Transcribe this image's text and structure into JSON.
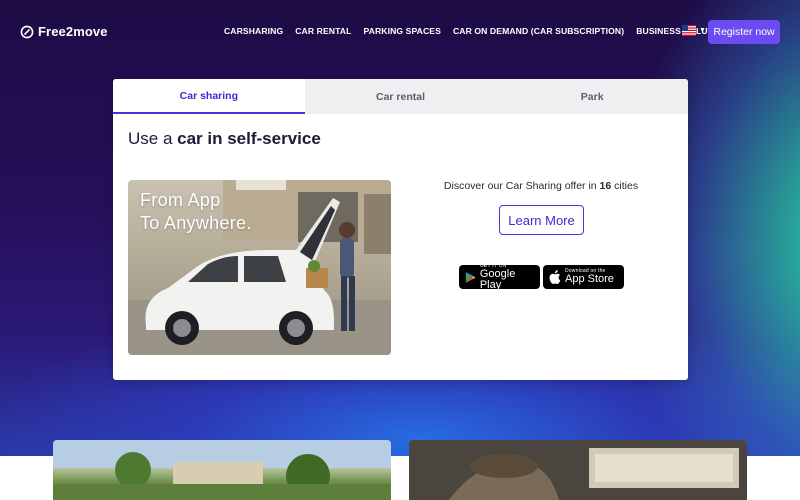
{
  "brand": {
    "name": "Free2move"
  },
  "nav": {
    "links": [
      "CARSHARING",
      "CAR RENTAL",
      "PARKING SPACES",
      "CAR ON DEMAND (CAR SUBSCRIPTION)",
      "BUSINESS SOLUTIONS"
    ],
    "language_icon": "us-flag-icon",
    "register_label": "Register now"
  },
  "card": {
    "tabs": [
      "Car sharing",
      "Car rental",
      "Park"
    ],
    "active_tab": "Car sharing",
    "title_prefix": "Use a ",
    "title_bold": "car in self-service",
    "promo": {
      "line1": "From App",
      "line2": "To Anywhere."
    },
    "offer_prefix": "Discover our Car Sharing offer in ",
    "offer_count": "16",
    "offer_suffix": " cities",
    "learn_more_label": "Learn More",
    "google_play": {
      "small": "GET IT ON",
      "big": "Google Play"
    },
    "app_store": {
      "small": "Download on the",
      "big": "App Store"
    }
  },
  "colors": {
    "accent": "#6c4cf2",
    "active_tab": "#3b2bd1",
    "hero_dark": "#1d0b45"
  }
}
